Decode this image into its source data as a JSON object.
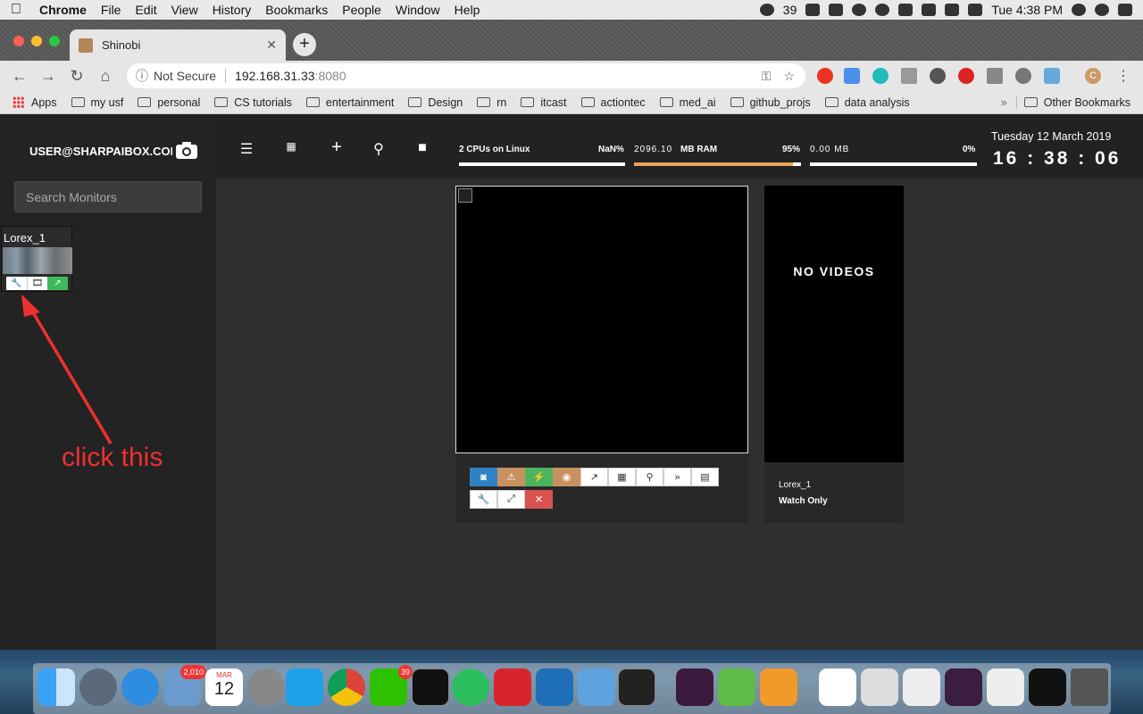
{
  "menubar": {
    "app": "Chrome",
    "items": [
      "File",
      "Edit",
      "View",
      "History",
      "Bookmarks",
      "People",
      "Window",
      "Help"
    ],
    "wechat_count": "39",
    "clock": "Tue 4:38 PM"
  },
  "browser": {
    "tab_title": "Shinobi",
    "security": "Not Secure",
    "url_host": "192.168.31.33",
    "url_port": ":8080",
    "profile_initial": "C",
    "bookmarks": [
      "Apps",
      "my usf",
      "personal",
      "CS tutorials",
      "entertainment",
      "Design",
      "rn",
      "itcast",
      "actiontec",
      "med_ai",
      "github_projs",
      "data analysis"
    ],
    "other_bookmarks": "Other Bookmarks",
    "overflow": "»"
  },
  "sidebar": {
    "user": "USER@SHARPAIBOX.COM",
    "search_placeholder": "Search Monitors",
    "monitor_title": "Lorex_1"
  },
  "topbar": {
    "cpu_label": "2 CPUs on Linux",
    "cpu_value": "NaN%",
    "ram_value": "2096.10",
    "ram_unit": "MB RAM",
    "ram_pct": "95%",
    "ram_fraction": 0.95,
    "disk_value": "0.00 MB",
    "disk_pct": "0%",
    "date": "Tuesday 12 March 2019",
    "time": "16 : 38 : 06"
  },
  "videos_panel": {
    "empty": "NO VIDEOS",
    "monitor": "Lorex_1",
    "mode": "Watch Only"
  },
  "annotation": {
    "text": "click this",
    "color": "#f0302f"
  },
  "dock": {
    "mail_badge": "2,010",
    "calendar_month": "MAR",
    "calendar_day": "12",
    "wechat_badge": "39"
  }
}
